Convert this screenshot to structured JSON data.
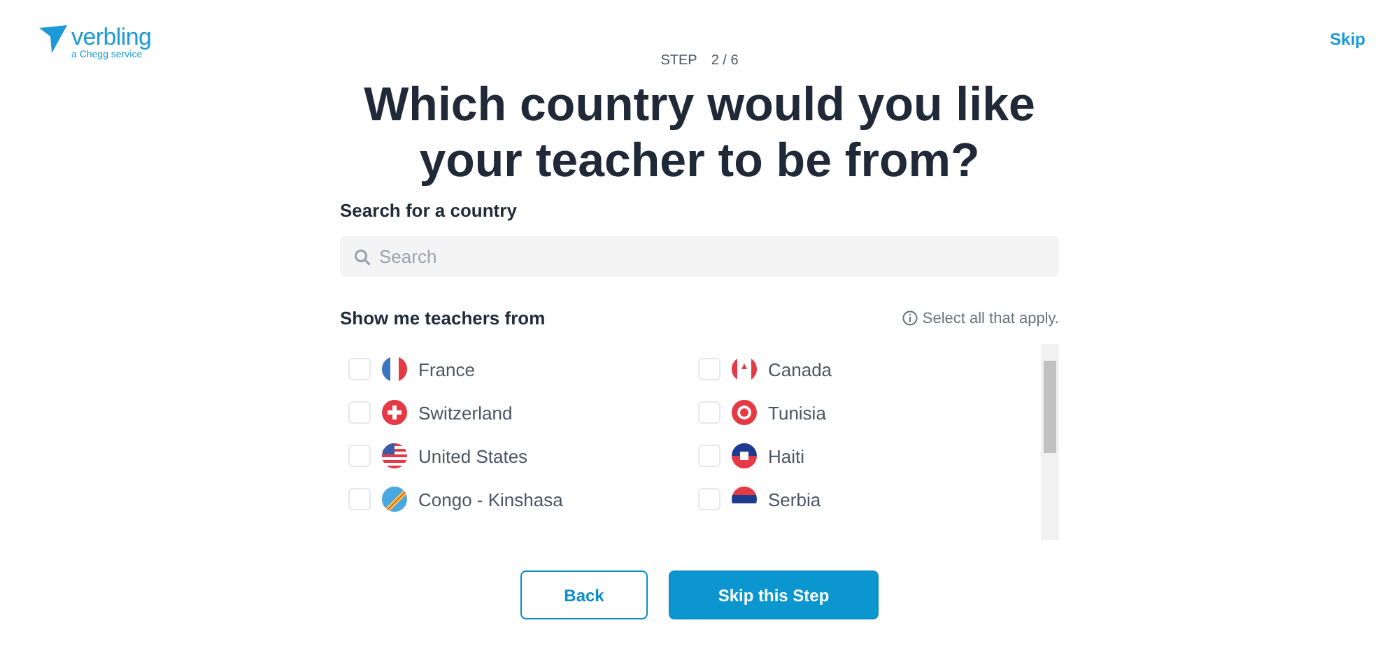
{
  "logo": {
    "name": "verbling",
    "tagline": "a Chegg service"
  },
  "header": {
    "skip": "Skip"
  },
  "step": {
    "label": "STEP",
    "value": "2 / 6"
  },
  "title": "Which country would you like your teacher to be from?",
  "search": {
    "label": "Search for a country",
    "placeholder": "Search"
  },
  "countries": {
    "label": "Show me teachers from",
    "hint": "Select all that apply.",
    "items": [
      {
        "name": "France",
        "checked": false
      },
      {
        "name": "Canada",
        "checked": false
      },
      {
        "name": "Switzerland",
        "checked": false
      },
      {
        "name": "Tunisia",
        "checked": false
      },
      {
        "name": "United States",
        "checked": false
      },
      {
        "name": "Haiti",
        "checked": false
      },
      {
        "name": "Congo - Kinshasa",
        "checked": false
      },
      {
        "name": "Serbia",
        "checked": false
      }
    ]
  },
  "buttons": {
    "back": "Back",
    "skip_step": "Skip this Step"
  }
}
